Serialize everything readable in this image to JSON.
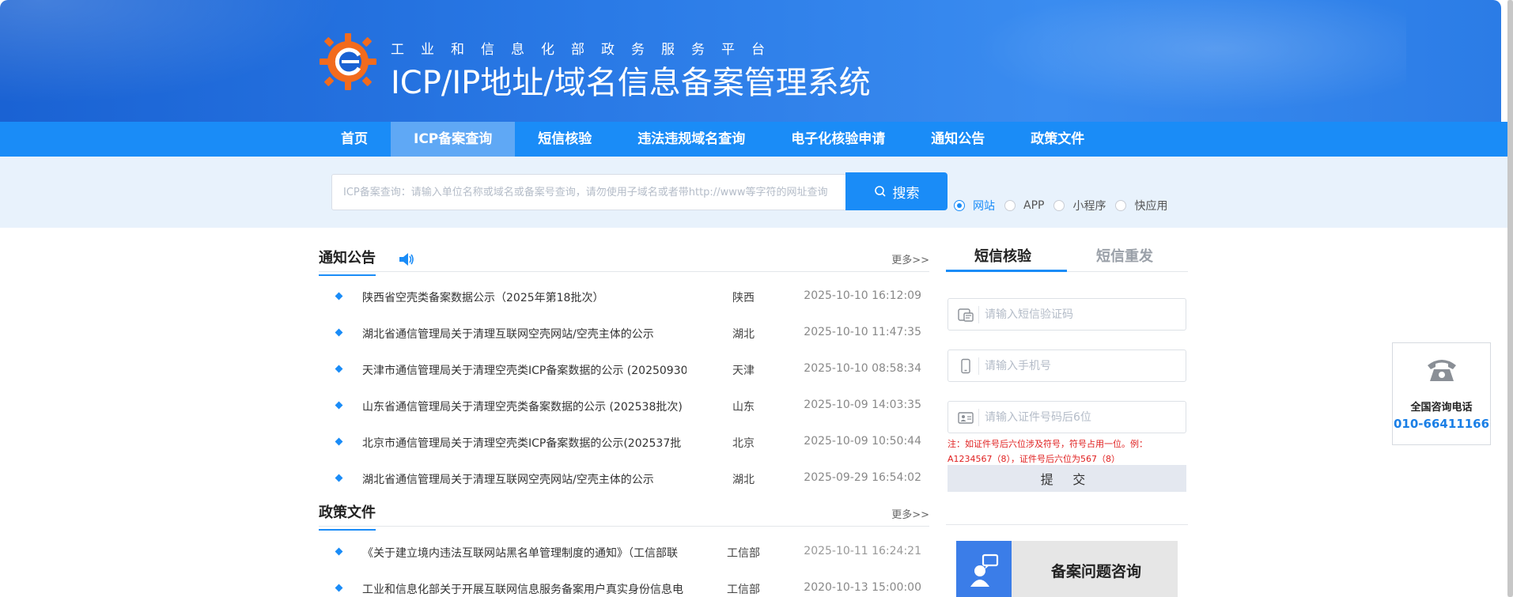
{
  "header": {
    "subtitle": "工业和信息化部政务服务平台",
    "title": "ICP/IP地址/域名信息备案管理系统"
  },
  "nav": {
    "items": [
      {
        "label": "首页"
      },
      {
        "label": "ICP备案查询"
      },
      {
        "label": "短信核验"
      },
      {
        "label": "违法违规域名查询"
      },
      {
        "label": "电子化核验申请"
      },
      {
        "label": "通知公告"
      },
      {
        "label": "政策文件"
      }
    ],
    "active_index": 1
  },
  "search": {
    "placeholder": "ICP备案查询：请输入单位名称或域名或备案号查询，请勿使用子域名或者带http://www等字符的网址查询",
    "button_label": "搜索",
    "radios": [
      {
        "label": "网站",
        "checked": true
      },
      {
        "label": "APP",
        "checked": false
      },
      {
        "label": "小程序",
        "checked": false
      },
      {
        "label": "快应用",
        "checked": false
      }
    ]
  },
  "notices": {
    "title": "通知公告",
    "more": "更多>>",
    "items": [
      {
        "title": "陕西省空壳类备案数据公示（2025年第18批次）",
        "province": "陕西",
        "date": "2025-10-10 16:12:09"
      },
      {
        "title": "湖北省通信管理局关于清理互联网空壳网站/空壳主体的公示",
        "province": "湖北",
        "date": "2025-10-10 11:47:35"
      },
      {
        "title": "天津市通信管理局关于清理空壳类ICP备案数据的公示 (20250930",
        "province": "天津",
        "date": "2025-10-10 08:58:34"
      },
      {
        "title": "山东省通信管理局关于清理空壳类备案数据的公示 (202538批次)",
        "province": "山东",
        "date": "2025-10-09 14:03:35"
      },
      {
        "title": "北京市通信管理局关于清理空壳类ICP备案数据的公示(202537批",
        "province": "北京",
        "date": "2025-10-09 10:50:44"
      },
      {
        "title": "湖北省通信管理局关于清理互联网空壳网站/空壳主体的公示",
        "province": "湖北",
        "date": "2025-09-29 16:54:02"
      }
    ]
  },
  "policies": {
    "title": "政策文件",
    "more": "更多>>",
    "items": [
      {
        "title": "《关于建立境内违法互联网站黑名单管理制度的通知》（工信部联",
        "province": "工信部",
        "date": "2025-10-11 16:24:21"
      },
      {
        "title": "工业和信息化部关于开展互联网信息服务备案用户真实身份信息电",
        "province": "工信部",
        "date": "2020-10-13 15:00:00"
      }
    ]
  },
  "sms": {
    "tab_verify": "短信核验",
    "tab_resend": "短信重发",
    "code_placeholder": "请输入短信验证码",
    "phone_placeholder": "请输入手机号",
    "id_placeholder": "请输入证件号码后6位",
    "note": "注：如证件号后六位涉及符号，符号占用一位。例：A1234567（8），证件号后六位为567（8）",
    "submit_label": "提 交"
  },
  "consult": {
    "label": "备案问题咨询"
  },
  "hotline": {
    "label": "全国咨询电话",
    "number": "010-66411166"
  },
  "colors": {
    "primary": "#1a8cf7",
    "header": "#2a7ae6",
    "note_red": "#e02020"
  }
}
